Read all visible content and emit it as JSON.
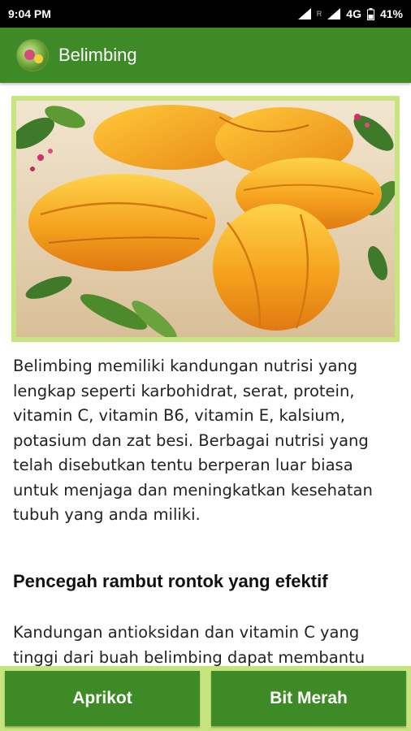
{
  "status_bar": {
    "time": "9:04 PM",
    "roaming": "R",
    "network": "4G",
    "battery": "41%",
    "icons": [
      "signal-icon",
      "signal-icon",
      "battery-icon"
    ]
  },
  "app_bar": {
    "title": "Belimbing",
    "logo_icon": "app-logo-icon"
  },
  "content": {
    "hero_image": "star-fruit-photo",
    "paragraph1": "Belimbing memiliki kandungan nutrisi yang lengkap seperti karbohidrat, serat, protein, vitamin C, vitamin B6, vitamin E, kalsium, potasium dan zat besi. Berbagai nutrisi yang telah disebutkan tentu berperan luar biasa untuk menjaga dan meningkatkan kesehatan tubuh yang anda miliki.",
    "section_heading": "Pencegah rambut rontok yang efektif",
    "paragraph2": "Kandungan antioksidan dan vitamin C yang tinggi dari buah belimbing dapat membantu mencegah kerontokan rambut."
  },
  "bottom_nav": {
    "prev_label": "Aprikot",
    "next_label": "Bit Merah"
  },
  "colors": {
    "primary": "#3d8a26",
    "accent_light": "#c6e57e",
    "status_bar": "#000000"
  }
}
